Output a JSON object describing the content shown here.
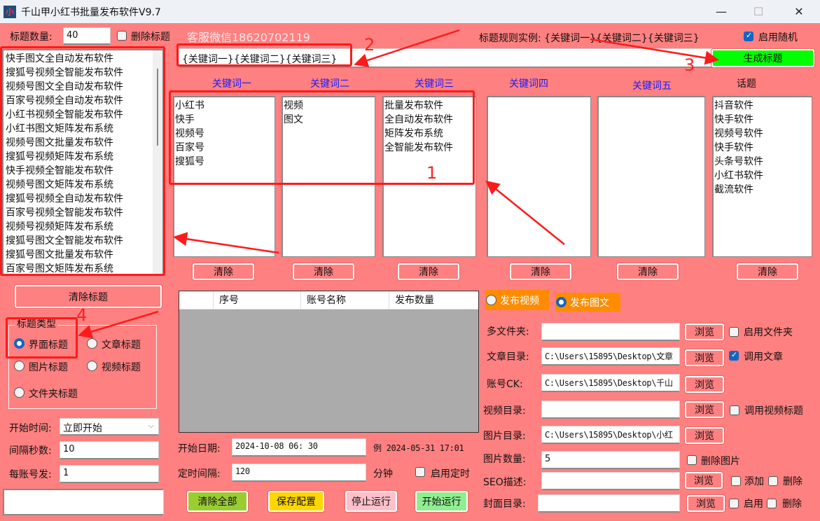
{
  "window": {
    "title": "千山甲小红书批量发布软件V9.7",
    "icon_glyph": "小",
    "controls": {
      "minimize": "—",
      "maximize": "☐",
      "close": "✕"
    }
  },
  "top": {
    "title_count_label": "标题数量:",
    "title_count_value": "40",
    "delete_titles_label": "删除标题",
    "delete_titles_checked": false,
    "service_wechat": "客服微信18620702119",
    "rule_example_label": "标题规则实例: {关键词一}{关键词二}{关键词三}",
    "enable_random_label": "启用随机",
    "enable_random_checked": true,
    "rule_input_value": "{关键词一}{关键词二}{关键词三}",
    "generate_button": "生成标题"
  },
  "titles_list": [
    "快手图文全自动发布软件",
    "搜狐号视频全智能发布软件",
    "视频号图文全自动发布软件",
    "百家号视频全自动发布软件",
    "小红书视频全智能发布软件",
    "小红书图文矩阵发布系统",
    "视频号图文批量发布软件",
    "搜狐号视频矩阵发布系统",
    "快手视频全智能发布软件",
    "视频号图文矩阵发布系统",
    "搜狐号视频全自动发布软件",
    "百家号视频全智能发布软件",
    "视频号视频矩阵发布系统",
    "搜狐号图文全智能发布软件",
    "搜狐号图文批量发布软件",
    "百家号图文矩阵发布系统"
  ],
  "keyword_columns": [
    {
      "header": "关键词一",
      "items": [
        "小红书",
        "快手",
        "视频号",
        "百家号",
        "搜狐号"
      ],
      "clear": "清除"
    },
    {
      "header": "关键词二",
      "items": [
        "视频",
        "图文"
      ],
      "clear": "清除"
    },
    {
      "header": "关键词三",
      "items": [
        "批量发布软件",
        "全自动发布软件",
        "矩阵发布系统",
        "全智能发布软件"
      ],
      "clear": "清除"
    },
    {
      "header": "关键词四",
      "items": [],
      "clear": "清除"
    },
    {
      "header": "关键词五",
      "items": [],
      "clear": "清除"
    },
    {
      "header": "话题",
      "items": [
        "抖音软件",
        "快手软件",
        "视频号软件",
        "快手软件",
        "头条号软件",
        "小红书软件",
        "截流软件"
      ],
      "clear": "清除"
    }
  ],
  "left_panel": {
    "clear_titles_button": "清除标题",
    "title_type_group": "标题类型",
    "title_types": [
      {
        "label": "界面标题",
        "selected": true
      },
      {
        "label": "文章标题",
        "selected": false
      },
      {
        "label": "图片标题",
        "selected": false
      },
      {
        "label": "视频标题",
        "selected": false
      },
      {
        "label": "文件夹标题",
        "selected": false
      }
    ],
    "start_time_label": "开始时间:",
    "start_time_value": "立即开始",
    "interval_seconds_label": "间隔秒数:",
    "interval_seconds_value": "10",
    "per_account_label": "每账号发:",
    "per_account_value": "1",
    "log_value": ""
  },
  "accounts_table": {
    "columns": [
      "",
      "序号",
      "账号名称",
      "发布数量"
    ],
    "rows": []
  },
  "schedule": {
    "start_date_label": "开始日期:",
    "start_date_value": "2024-10-08 06: 30",
    "example_text": "例 2024-05-31 17:01",
    "timer_interval_label": "定时间隔:",
    "timer_interval_value": "120",
    "minutes_label": "分钟",
    "enable_timer_label": "启用定时",
    "enable_timer_checked": false
  },
  "action_buttons": {
    "clear_all": {
      "label": "清除全部",
      "color": "#9acd32"
    },
    "save_config": {
      "label": "保存配置",
      "color": "#ffd700"
    },
    "stop": {
      "label": "停止运行",
      "color": "#ffc0cb"
    },
    "start": {
      "label": "开始运行",
      "color": "#90ee90"
    }
  },
  "publish_mode": {
    "video_label": "发布视频",
    "image_label": "发布图文",
    "selected": "图文",
    "badge_color": "#ff8c00"
  },
  "right_form": {
    "browse": "浏览",
    "multi_folder_label": "多文件夹:",
    "multi_folder_value": "",
    "enable_folder_label": "启用文件夹",
    "enable_folder_checked": false,
    "article_dir_label": "文章目录:",
    "article_dir_value": "C:\\Users\\15895\\Desktop\\文章",
    "use_article_label": "调用文章",
    "use_article_checked": true,
    "account_ck_label": "账号CK:",
    "account_ck_value": "C:\\Users\\15895\\Desktop\\千山",
    "video_dir_label": "视频目录:",
    "video_dir_value": "",
    "use_video_title_label": "调用视频标题",
    "use_video_title_checked": false,
    "image_dir_label": "图片目录:",
    "image_dir_value": "C:\\Users\\15895\\Desktop\\小红",
    "image_count_label": "图片数量:",
    "image_count_value": "5",
    "delete_images_label": "删除图片",
    "delete_images_checked": false,
    "seo_label": "SEO描述:",
    "seo_value": "",
    "seo_add_label": "添加",
    "seo_delete_label": "删除",
    "cover_dir_label": "封面目录:",
    "cover_dir_value": "",
    "cover_enable_label": "启用",
    "cover_delete_label": "删除"
  },
  "annotations": [
    "1",
    "2",
    "3",
    "4"
  ],
  "colors": {
    "background": "#ff8080",
    "annotation": "#ff1a1a",
    "generate_button": "#00ff00",
    "keyword_header": "#1a1aff"
  }
}
